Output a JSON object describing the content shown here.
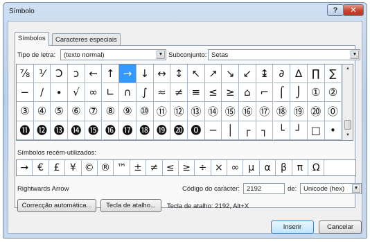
{
  "window": {
    "title": "Símbolo"
  },
  "tabs": [
    {
      "label": "Símbolos",
      "active": true
    },
    {
      "label": "Caracteres especiais",
      "active": false
    }
  ],
  "font": {
    "label": "Tipo de letra:",
    "value": "(texto normal)"
  },
  "subset": {
    "label": "Subconjunto:",
    "value": "Setas"
  },
  "grid_rows": [
    [
      "⅞",
      "⅟",
      "Ↄ",
      "ↄ",
      "←",
      "↑",
      "→",
      "↓",
      "↔",
      "↕",
      "↖",
      "↗",
      "↘",
      "↙",
      "↨",
      "∂",
      "∆",
      "∏",
      "∑"
    ],
    [
      "−",
      "∕",
      "∙",
      "√",
      "∞",
      "∟",
      "∩",
      "∫",
      "≈",
      "≠",
      "≡",
      "≤",
      "≥",
      "⌂",
      "⌐",
      "⌠",
      "⌡",
      "①",
      "②"
    ],
    [
      "③",
      "④",
      "⑤",
      "⑥",
      "⑦",
      "⑧",
      "⑨",
      "⑩",
      "⑪",
      "⑫",
      "⑬",
      "⑭",
      "⑮",
      "⑯",
      "⑰",
      "⑱",
      "⑲",
      "⑳",
      "⓪"
    ],
    [
      "⓫",
      "⓬",
      "⓭",
      "⓮",
      "⓯",
      "⓰",
      "⓱",
      "⓲",
      "⓳",
      "⓴",
      "⓿",
      "─",
      "│",
      "┌",
      "┐",
      "└",
      "┘",
      "□",
      "•"
    ]
  ],
  "selected": {
    "row": 0,
    "col": 6
  },
  "recent": {
    "label": "Símbolos recém-utilizados:",
    "symbols": [
      "→",
      "€",
      "£",
      "¥",
      "©",
      "®",
      "™",
      "±",
      "≠",
      "≤",
      "≥",
      "÷",
      "×",
      "∞",
      "µ",
      "α",
      "β",
      "π",
      "Ω"
    ]
  },
  "char_name": "Rightwards Arrow",
  "char_code": {
    "label": "Código do carácter:",
    "value": "2192"
  },
  "from": {
    "label": "de:",
    "value": "Unicode (hex)"
  },
  "buttons": {
    "autocorrect": "Correcção automática...",
    "shortcut": "Tecla de atalho...",
    "insert": "Inserir",
    "cancel": "Cancelar"
  },
  "shortcut_text": "Tecla de atalho: 2192, Alt+X",
  "icons": {
    "help": "?",
    "close": "✕",
    "dropdown": "▼",
    "scroll_up": "▲",
    "scroll_down": "▼"
  }
}
